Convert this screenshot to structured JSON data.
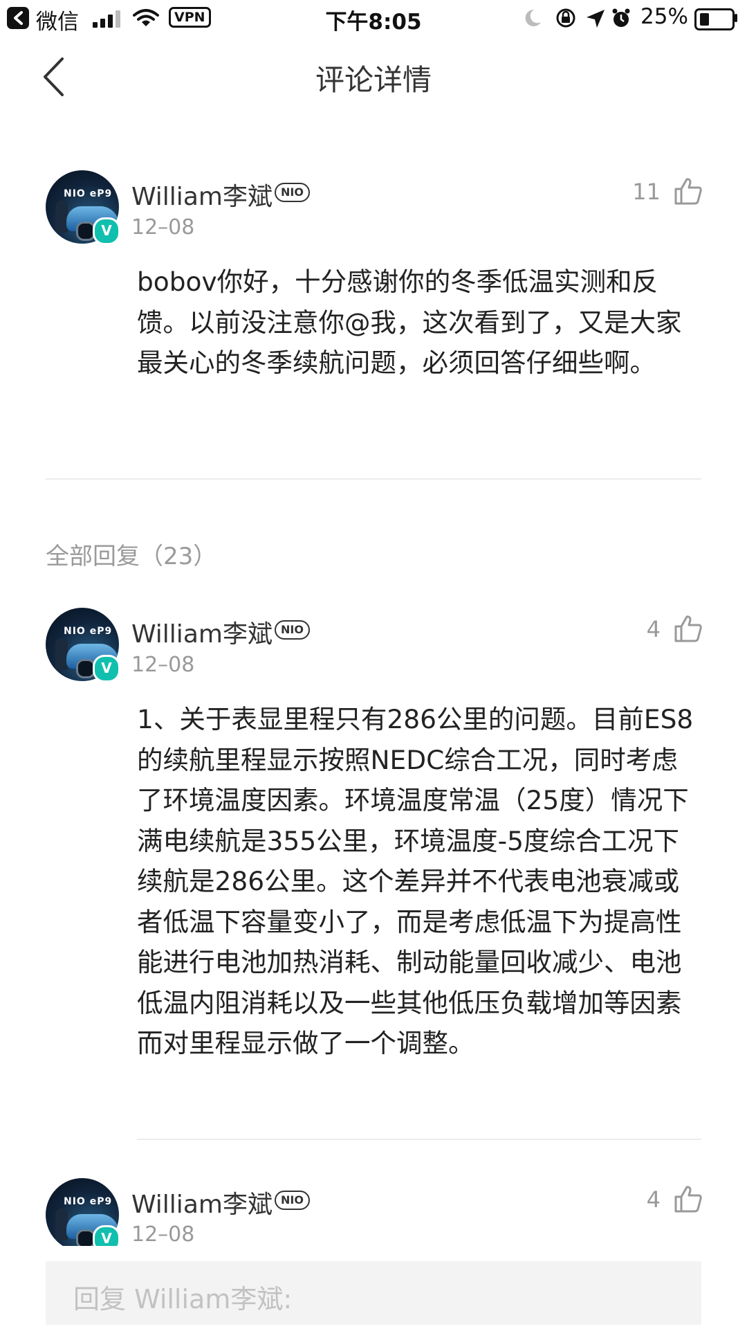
{
  "status_bar": {
    "back_app": "微信",
    "network": "VPN",
    "time": "下午8:05",
    "battery": "25%"
  },
  "nav": {
    "title": "评论详情"
  },
  "main_comment": {
    "author": "William李斌",
    "badge": "NIO",
    "avatar_text": "NIO eP9",
    "verified_mark": "V",
    "date": "12–08",
    "likes": "11",
    "body": "bobov你好，十分感谢你的冬季低温实测和反馈。以前没注意你@我，这次看到了，又是大家最关心的冬季续航问题，必须回答仔细些啊。"
  },
  "replies_header": "全部回复（23）",
  "replies": [
    {
      "author": "William李斌",
      "badge": "NIO",
      "avatar_text": "NIO eP9",
      "verified_mark": "V",
      "date": "12–08",
      "likes": "4",
      "body": "1、关于表显里程只有286公里的问题。目前ES8的续航里程显示按照NEDC综合工况，同时考虑了环境温度因素。环境温度常温（25度）情况下满电续航是355公里，环境温度-5度综合工况下续航是286公里。这个差异并不代表电池衰减或者低温下容量变小了，而是考虑低温下为提高性能进行电池加热消耗、制动能量回收减少、电池低温内阻消耗以及一些其他低压负载增加等因素而对里程显示做了一个调整。"
    },
    {
      "author": "William李斌",
      "badge": "NIO",
      "avatar_text": "NIO eP9",
      "verified_mark": "V",
      "date": "12–08",
      "likes": "4"
    }
  ],
  "reply_input": {
    "placeholder": "回复 William李斌:"
  }
}
